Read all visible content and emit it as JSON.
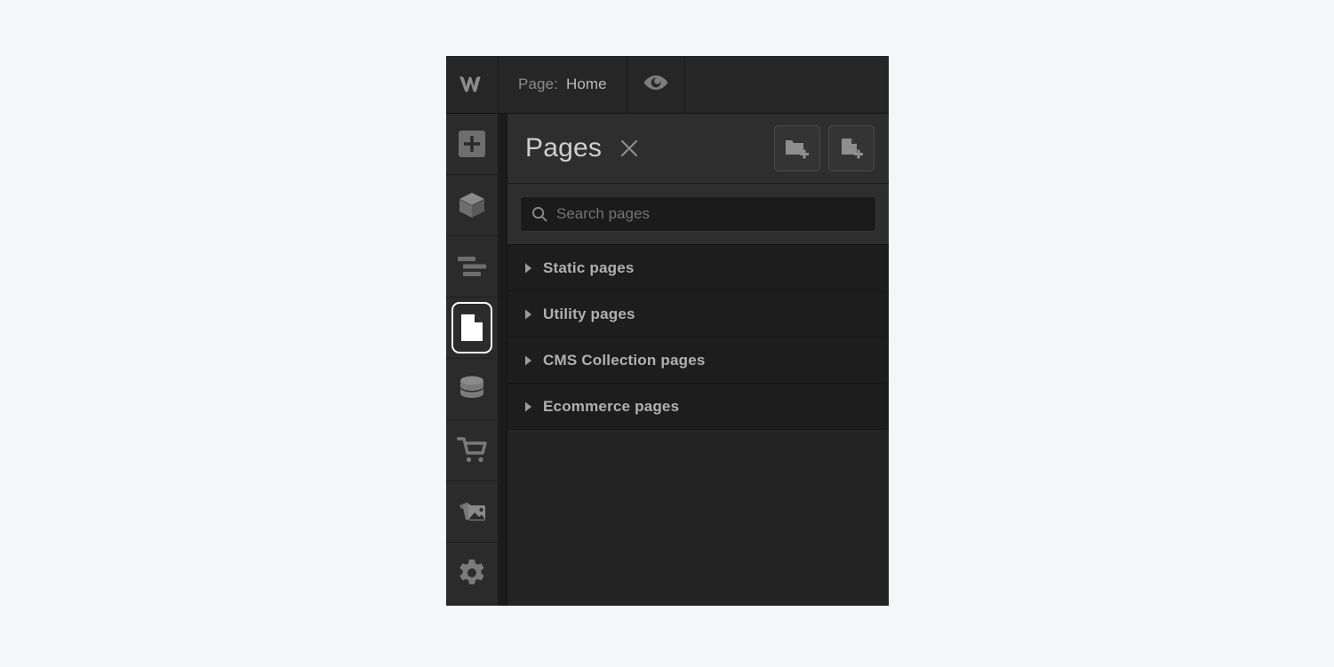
{
  "app": {
    "name": "Webflow Designer",
    "logo_icon": "webflow-w-logo"
  },
  "topbar": {
    "page_label": "Page:",
    "page_value": "Home",
    "preview_icon": "eye-icon"
  },
  "sidebar": {
    "items": [
      {
        "id": "add",
        "label": "Add elements",
        "icon": "plus-square-icon",
        "active": false
      },
      {
        "id": "components",
        "label": "Components",
        "icon": "cube-icon",
        "active": false
      },
      {
        "id": "navigator",
        "label": "Navigator",
        "icon": "navigator-lines-icon",
        "active": false
      },
      {
        "id": "pages",
        "label": "Pages",
        "icon": "page-document-icon",
        "active": true
      },
      {
        "id": "cms",
        "label": "CMS Collections",
        "icon": "database-icon",
        "active": false
      },
      {
        "id": "ecommerce",
        "label": "Ecommerce",
        "icon": "shopping-cart-icon",
        "active": false
      },
      {
        "id": "assets",
        "label": "Assets",
        "icon": "images-icon",
        "active": false
      },
      {
        "id": "settings",
        "label": "Settings",
        "icon": "gear-icon",
        "active": false
      }
    ]
  },
  "panel": {
    "title": "Pages",
    "close_icon": "close-x-icon",
    "actions": [
      {
        "id": "new-folder",
        "label": "New folder",
        "icon": "folder-plus-icon"
      },
      {
        "id": "new-page",
        "label": "New page",
        "icon": "page-plus-icon"
      }
    ],
    "search": {
      "placeholder": "Search pages",
      "value": "",
      "icon": "search-icon"
    },
    "groups": [
      {
        "id": "static",
        "label": "Static pages",
        "expanded": false
      },
      {
        "id": "utility",
        "label": "Utility pages",
        "expanded": false
      },
      {
        "id": "cms-collection",
        "label": "CMS Collection pages",
        "expanded": false
      },
      {
        "id": "ecommerce",
        "label": "Ecommerce pages",
        "expanded": false
      }
    ]
  },
  "colors": {
    "canvas": "#f5f6f8",
    "topbar_bg": "#262626",
    "rail_bg": "#2b2b2b",
    "panel_header_bg": "#2e2e2e",
    "row_bg": "#1d1d1d",
    "list_bg": "#242424",
    "text_primary": "#cfcfcf",
    "text_secondary": "#8a8a8a",
    "active_outline": "#ffffff"
  }
}
